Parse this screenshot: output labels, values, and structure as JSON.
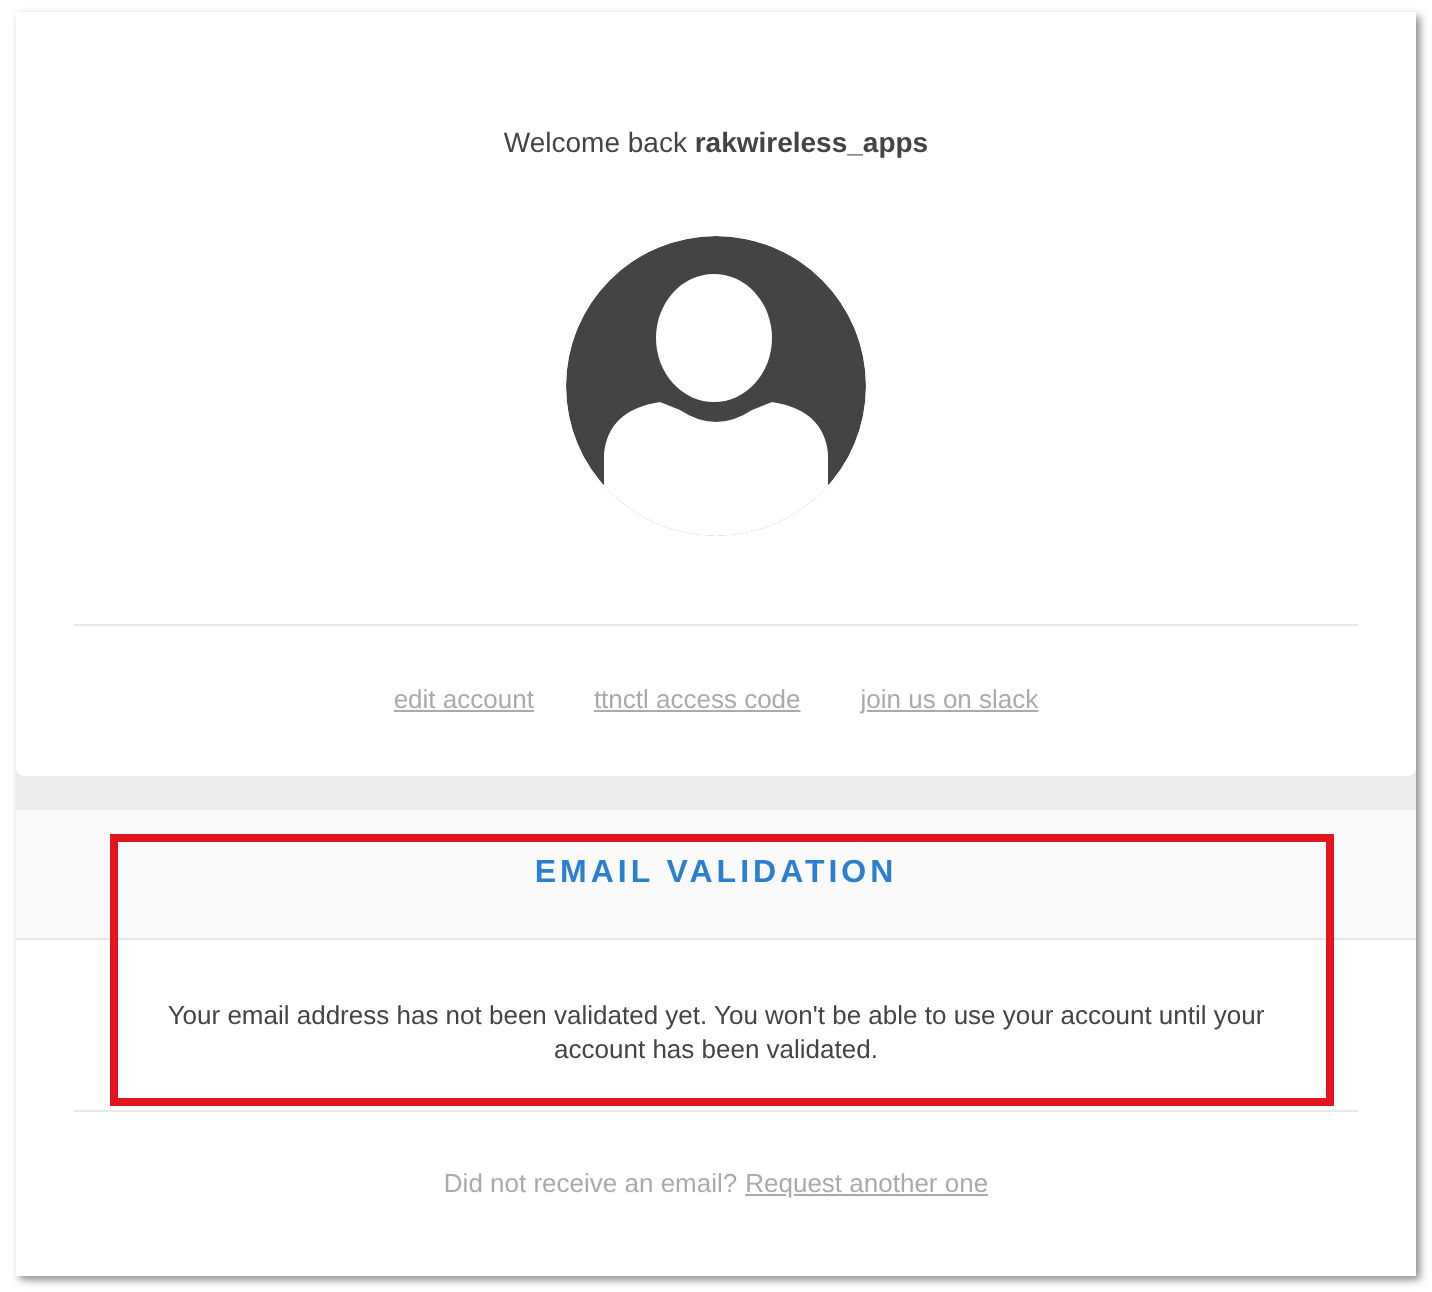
{
  "profile": {
    "welcome": "Welcome back **rakwireless_apps**",
    "links": [
      "edit account",
      "ttnctl access code",
      "join us on slack"
    ]
  },
  "validation": {
    "title": "EMAIL VALIDATION",
    "message": "Your email address has not been validated yet. You won't be able to use your account until your account has been validated.",
    "highlighted": true,
    "footer_text": "Did not receive an email?",
    "footer_link": "Request another one"
  }
}
